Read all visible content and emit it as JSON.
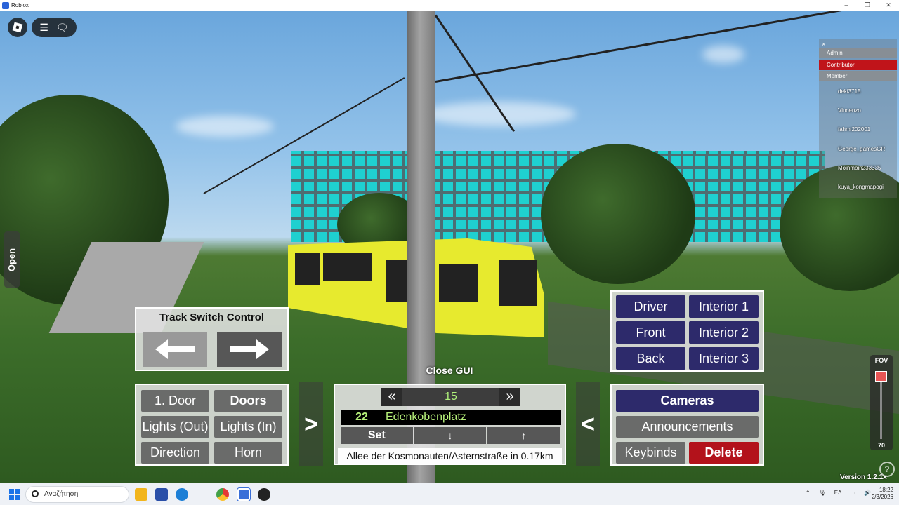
{
  "window": {
    "title": "Roblox",
    "controls": [
      "–",
      "❐",
      "✕"
    ]
  },
  "side_tab": {
    "label": "Open"
  },
  "playerlist": {
    "close": "×",
    "groups": [
      "Admin",
      "Contributor",
      "Member"
    ],
    "players": [
      "deki3715",
      "Vincenzo",
      "fahmi202001",
      "George_gamesGR",
      "Moinmoin233335",
      "kuya_kongmapogi"
    ]
  },
  "track_switch": {
    "title": "Track Switch Control"
  },
  "controls_left": {
    "door1": "1. Door",
    "doors": "Doors",
    "lights_out": "Lights (Out)",
    "lights_in": "Lights (In)",
    "direction": "Direction",
    "horn": "Horn"
  },
  "arrows": {
    "left_toggle": ">",
    "right_toggle": "<"
  },
  "close_gui": "Close GUI",
  "destination": {
    "prev": "«",
    "number": "15",
    "next": "»",
    "line": "22",
    "name": "Edenkobenplatz",
    "set": "Set",
    "down": "↓",
    "up": "↑",
    "status": "Allee der Kosmonauten/Asternstraße in 0.17km"
  },
  "camera_select": {
    "driver": "Driver",
    "interior1": "Interior 1",
    "front": "Front",
    "interior2": "Interior 2",
    "back": "Back",
    "interior3": "Interior 3"
  },
  "menu": {
    "cameras": "Cameras",
    "announcements": "Announcements",
    "keybinds": "Keybinds",
    "delete": "Delete"
  },
  "fov": {
    "label": "FOV",
    "value": "70",
    "level": 0.05
  },
  "version": "Version 1.2.1x",
  "help": "?",
  "taskbar": {
    "search_placeholder": "Αναζήτηση",
    "lang": "ΕΛ",
    "time": "18:22",
    "date": "2/3/2026"
  },
  "colors": {
    "navy": "#2d2a6b",
    "red": "#b3121b",
    "line_green": "#b6f07a"
  }
}
